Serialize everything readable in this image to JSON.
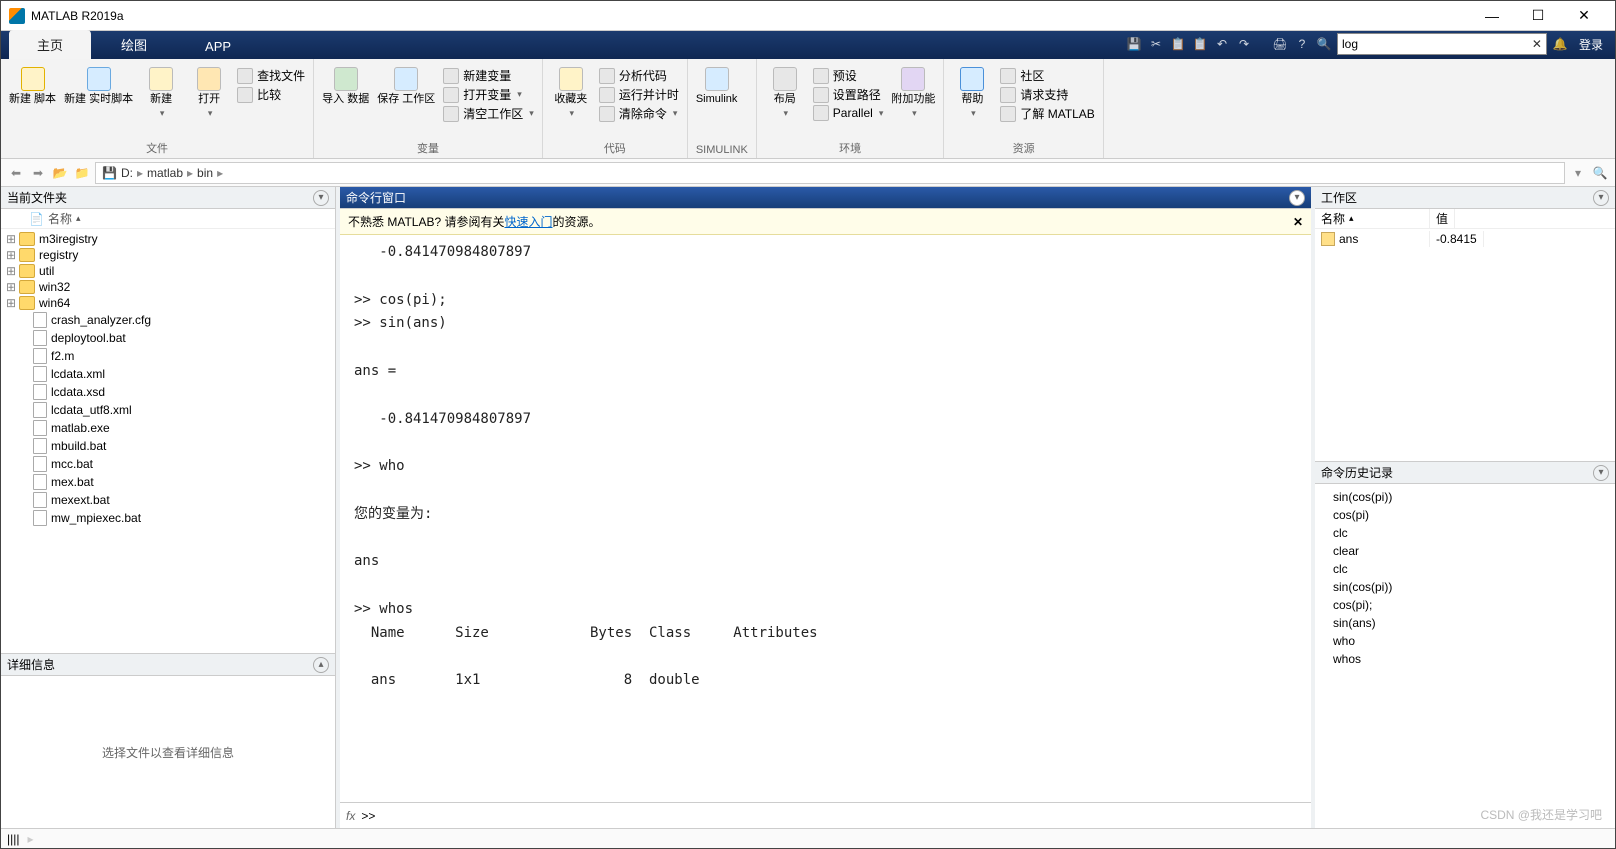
{
  "title": "MATLAB R2019a",
  "window_buttons": {
    "min": "—",
    "max": "☐",
    "close": "✕"
  },
  "tabs": {
    "home": "主页",
    "plot": "绘图",
    "app": "APP"
  },
  "search": {
    "value": "log",
    "clear": "✕"
  },
  "login": "登录",
  "ribbon_icons": [
    "💾",
    "✂",
    "📋",
    "📋",
    "↶",
    "↷",
    "",
    "🖨",
    "?",
    "🔍"
  ],
  "ribbon": {
    "file": {
      "label": "文件",
      "new_script": "新建\n脚本",
      "new_live": "新建\n实时脚本",
      "new": "新建",
      "open": "打开",
      "find_files": "查找文件",
      "compare": "比较"
    },
    "var": {
      "label": "变量",
      "import": "导入\n数据",
      "save_ws": "保存\n工作区",
      "new_var": "新建变量",
      "open_var": "打开变量",
      "clear_ws": "清空工作区"
    },
    "code": {
      "label": "代码",
      "favorites": "收藏夹",
      "analyze": "分析代码",
      "run_time": "运行并计时",
      "clear_cmd": "清除命令"
    },
    "simulink": {
      "label": "SIMULINK",
      "btn": "Simulink"
    },
    "env": {
      "label": "环境",
      "layout": "布局",
      "prefs": "预设",
      "set_path": "设置路径",
      "parallel": "Parallel",
      "addons": "附加功能"
    },
    "res": {
      "label": "资源",
      "help": "帮助",
      "community": "社区",
      "support": "请求支持",
      "learn": "了解 MATLAB"
    }
  },
  "path": {
    "drive": "D:",
    "p1": "matlab",
    "p2": "bin"
  },
  "current_folder": {
    "title": "当前文件夹",
    "name_hdr": "名称",
    "folders": [
      "m3iregistry",
      "registry",
      "util",
      "win32",
      "win64"
    ],
    "files": [
      "crash_analyzer.cfg",
      "deploytool.bat",
      "f2.m",
      "lcdata.xml",
      "lcdata.xsd",
      "lcdata_utf8.xml",
      "matlab.exe",
      "mbuild.bat",
      "mcc.bat",
      "mex.bat",
      "mexext.bat",
      "mw_mpiexec.bat"
    ]
  },
  "details": {
    "title": "详细信息",
    "msg": "选择文件以查看详细信息"
  },
  "cmd": {
    "title": "命令行窗口",
    "banner_pre": "不熟悉 MATLAB? 请参阅有关",
    "banner_link": "快速入门",
    "banner_post": "的资源。",
    "content": "   -0.841470984807897\n\n>> cos(pi);\n>> sin(ans)\n\nans =\n\n   -0.841470984807897\n\n>> who\n\n您的变量为:\n\nans\n\n>> whos\n  Name      Size            Bytes  Class     Attributes\n\n  ans       1x1                 8  double",
    "prompt": ">>"
  },
  "workspace": {
    "title": "工作区",
    "col_name": "名称",
    "col_value": "值",
    "vars": [
      {
        "name": "ans",
        "value": "-0.8415"
      }
    ]
  },
  "history": {
    "title": "命令历史记录",
    "items": [
      "sin(cos(pi))",
      "cos(pi)",
      "clc",
      "clear",
      "clc",
      "sin(cos(pi))",
      "cos(pi);",
      "sin(ans)",
      "who",
      "whos"
    ]
  },
  "watermark": "CSDN @我还是学习吧"
}
